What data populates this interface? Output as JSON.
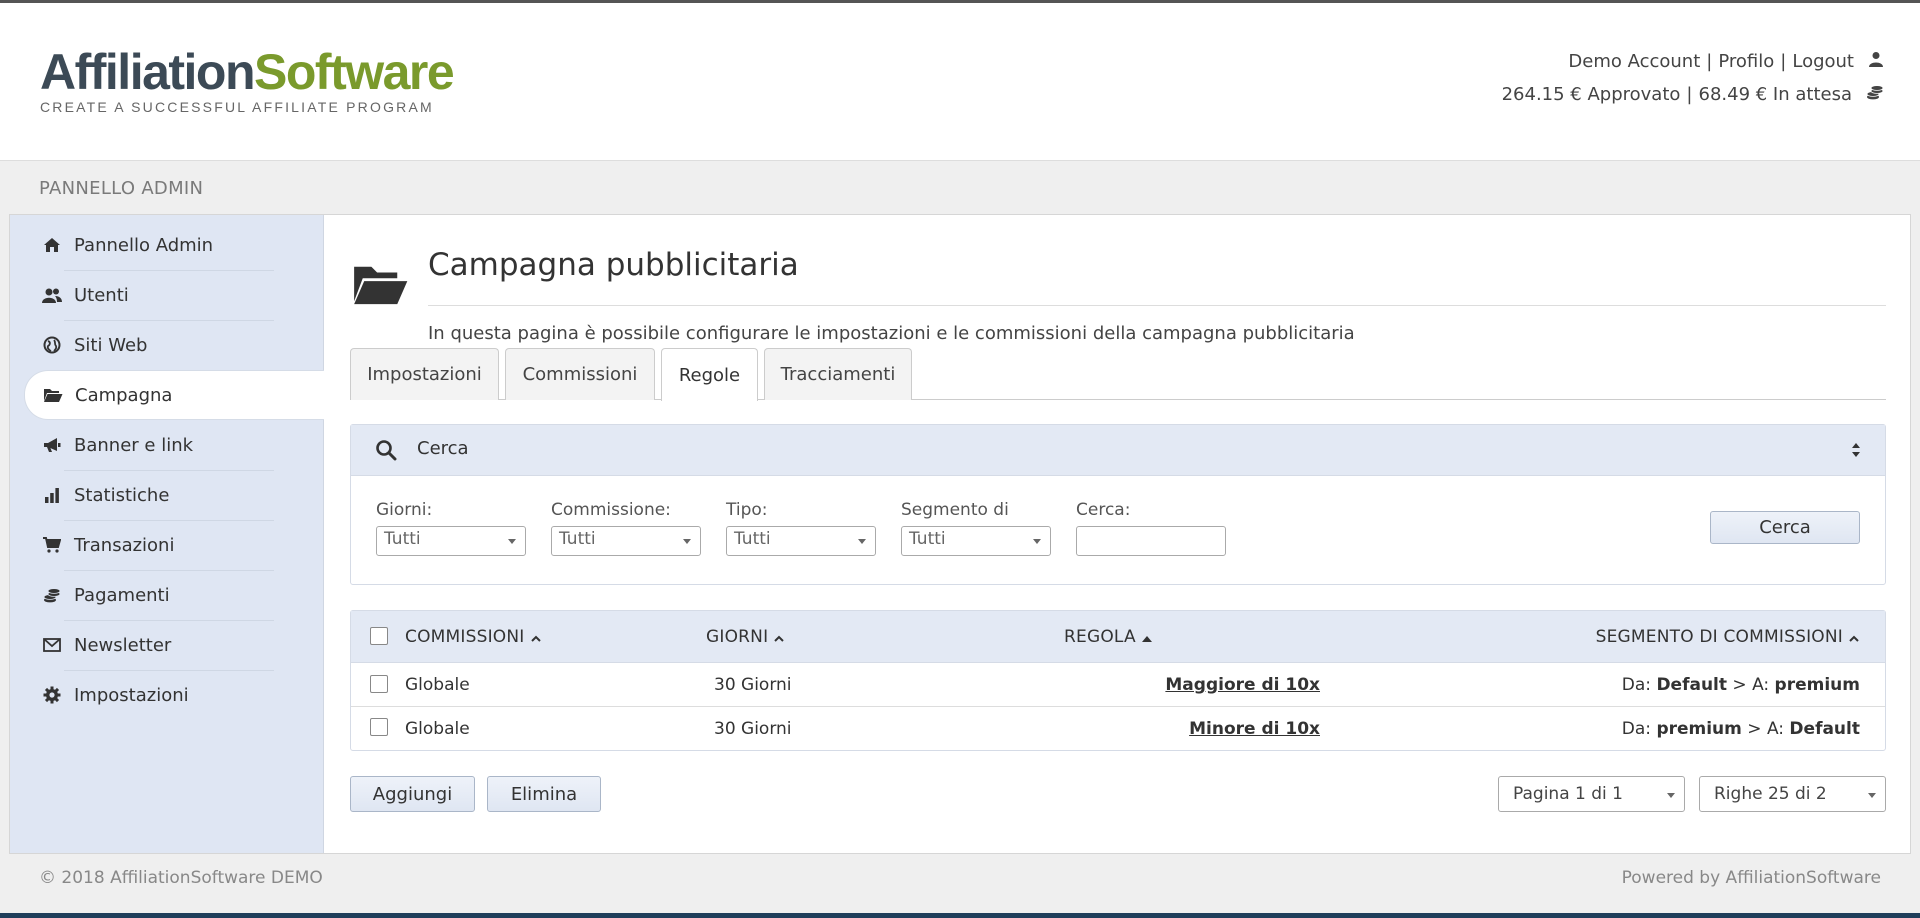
{
  "header": {
    "logo": {
      "part1": "Affiliation",
      "part2": "Software",
      "tagline": "CREATE A SUCCESSFUL AFFILIATE PROGRAM"
    },
    "user": {
      "account": "Demo Account",
      "profile": "Profilo",
      "logout": "Logout",
      "separator": "|"
    },
    "balance": {
      "approved": "264.15 € Approvato",
      "pending": "68.49 € In attesa",
      "separator": "|"
    }
  },
  "panel": {
    "title": "PANNELLO ADMIN"
  },
  "sidebar": {
    "items": [
      {
        "label": "Pannello Admin",
        "icon": "home-icon"
      },
      {
        "label": "Utenti",
        "icon": "users-icon"
      },
      {
        "label": "Siti Web",
        "icon": "globe-icon"
      },
      {
        "label": "Campagna",
        "icon": "folder-open-icon",
        "active": true
      },
      {
        "label": "Banner e link",
        "icon": "megaphone-icon"
      },
      {
        "label": "Statistiche",
        "icon": "bar-chart-icon"
      },
      {
        "label": "Transazioni",
        "icon": "cart-icon"
      },
      {
        "label": "Pagamenti",
        "icon": "coins-icon"
      },
      {
        "label": "Newsletter",
        "icon": "envelope-icon"
      },
      {
        "label": "Impostazioni",
        "icon": "gear-icon"
      }
    ]
  },
  "page": {
    "title": "Campagna pubblicitaria",
    "description": "In questa pagina è possibile configurare le impostazioni e le commissioni della campagna pubblicitaria",
    "icon": "folder-open-icon"
  },
  "tabs": [
    {
      "label": "Impostazioni"
    },
    {
      "label": "Commissioni"
    },
    {
      "label": "Regole",
      "active": true
    },
    {
      "label": "Tracciamenti"
    }
  ],
  "search": {
    "title": "Cerca",
    "filters": [
      {
        "label": "Giorni:",
        "value": "Tutti"
      },
      {
        "label": "Commissione:",
        "value": "Tutti"
      },
      {
        "label": "Tipo:",
        "value": "Tutti"
      },
      {
        "label": "Segmento di",
        "value": "Tutti"
      }
    ],
    "text_label": "Cerca:",
    "text_value": "",
    "button": "Cerca"
  },
  "table": {
    "columns": [
      "COMMISSIONI",
      "GIORNI",
      "REGOLA",
      "SEGMENTO DI COMMISSIONI"
    ],
    "rows": [
      {
        "commission": "Globale",
        "days": "30 Giorni",
        "rule": "Maggiore di 10x",
        "from_label": "Da:",
        "from": "Default",
        "to_label": "> A:",
        "to": "premium"
      },
      {
        "commission": "Globale",
        "days": "30 Giorni",
        "rule": "Minore di 10x",
        "from_label": "Da:",
        "from": "premium",
        "to_label": "> A:",
        "to": "Default"
      }
    ]
  },
  "actions": {
    "add": "Aggiungi",
    "delete": "Elimina"
  },
  "pagination": {
    "page": "Pagina 1 di 1",
    "rows": "Righe 25 di 2"
  },
  "footer": {
    "copyright": "© 2018 AffiliationSoftware DEMO",
    "powered": "Powered by AffiliationSoftware"
  },
  "colors": {
    "brand_dark": "#3c4a56",
    "brand_green": "#7a9a2c",
    "sidebar_bg": "#dfe6f3",
    "bar_bg": "#e3e9f4"
  }
}
